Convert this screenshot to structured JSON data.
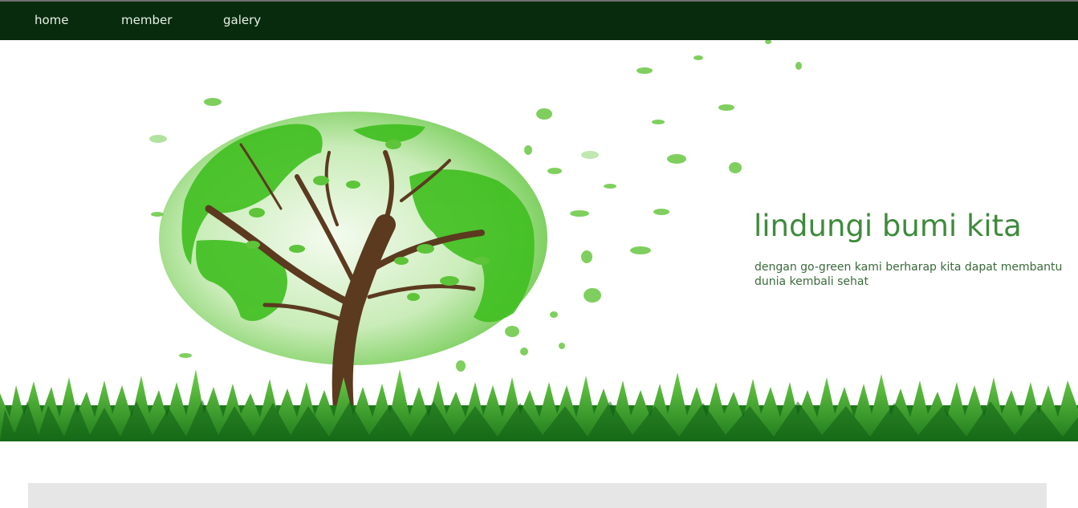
{
  "nav": {
    "items": [
      {
        "label": "home"
      },
      {
        "label": "member"
      },
      {
        "label": "galery"
      }
    ]
  },
  "hero": {
    "title": "lindungi bumi kita",
    "text": "dengan go-green kami berharap kita dapat membantu dunia kembali sehat",
    "image_icon": "green-earth-tree-icon"
  },
  "colors": {
    "nav_bg": "#072b0c",
    "nav_text": "#e8f1e8",
    "title": "#3f8a3c",
    "body_text": "#3a6a3a",
    "grass": "#2e9e2a",
    "content_box": "#e6e6e6"
  }
}
